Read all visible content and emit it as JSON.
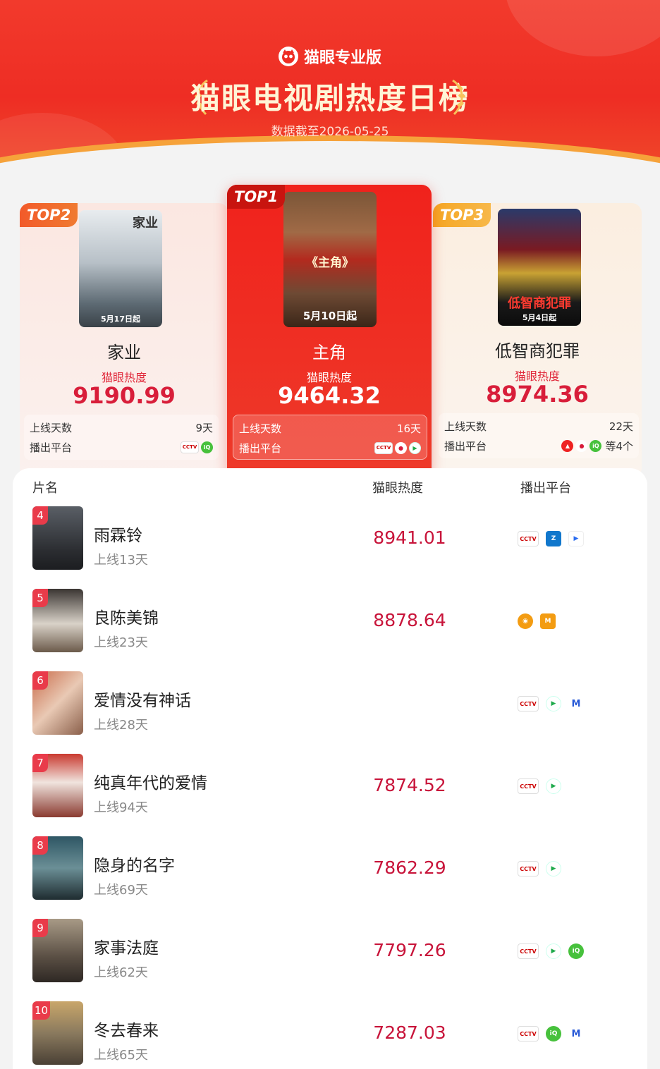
{
  "header": {
    "brand": "猫眼专业版",
    "title": "猫眼电视剧热度日榜",
    "date_line": "数据截至2026-05-25"
  },
  "labels": {
    "heat": "猫眼热度",
    "days_online": "上线天数",
    "platforms": "播出平台"
  },
  "top3": [
    {
      "badge": "TOP2",
      "name": "家业",
      "poster_title": "家业",
      "poster_caption": "5月17日起",
      "score": "9190.99",
      "days": "9天",
      "platforms": [
        "cctv",
        "iqiyi"
      ],
      "more": ""
    },
    {
      "badge": "TOP1",
      "name": "主角",
      "poster_title": "《主角》",
      "poster_caption": "5月10日起",
      "score": "9464.32",
      "days": "16天",
      "platforms": [
        "cctv",
        "migu",
        "tencent"
      ],
      "more": ""
    },
    {
      "badge": "TOP3",
      "name": "低智商犯罪",
      "poster_title": "低智商犯罪",
      "poster_caption": "5月4日起",
      "score": "8974.36",
      "days": "22天",
      "platforms": [
        "red",
        "migu",
        "iqiyi"
      ],
      "more": "等4个"
    }
  ],
  "list": {
    "columns": [
      "片名",
      "猫眼热度",
      "播出平台"
    ],
    "rows": [
      {
        "rank": "4",
        "name": "雨霖铃",
        "days": "上线13天",
        "score": "8941.01",
        "platforms": [
          "cctv",
          "zj",
          "youku"
        ]
      },
      {
        "rank": "5",
        "name": "良陈美锦",
        "days": "上线23天",
        "score": "8878.64",
        "platforms": [
          "mango",
          "mgtv"
        ]
      },
      {
        "rank": "6",
        "name": "爱情没有神话",
        "days": "上线28天",
        "score": "",
        "platforms": [
          "cctv",
          "tencent",
          "m"
        ]
      },
      {
        "rank": "7",
        "name": "纯真年代的爱情",
        "days": "上线94天",
        "score": "7874.52",
        "platforms": [
          "cctv",
          "tencent"
        ]
      },
      {
        "rank": "8",
        "name": "隐身的名字",
        "days": "上线69天",
        "score": "7862.29",
        "platforms": [
          "cctv",
          "tencent"
        ]
      },
      {
        "rank": "9",
        "name": "家事法庭",
        "days": "上线62天",
        "score": "7797.26",
        "platforms": [
          "cctv",
          "tencent",
          "iqiyi"
        ]
      },
      {
        "rank": "10",
        "name": "冬去春来",
        "days": "上线65天",
        "score": "7287.03",
        "platforms": [
          "cctv",
          "iqiyi",
          "m"
        ]
      }
    ]
  },
  "colors": {
    "header_red": "#ee2d24",
    "accent_gold": "#f6a23a",
    "score_red": "#c8143a",
    "rank_tag": "#e93b4a"
  }
}
